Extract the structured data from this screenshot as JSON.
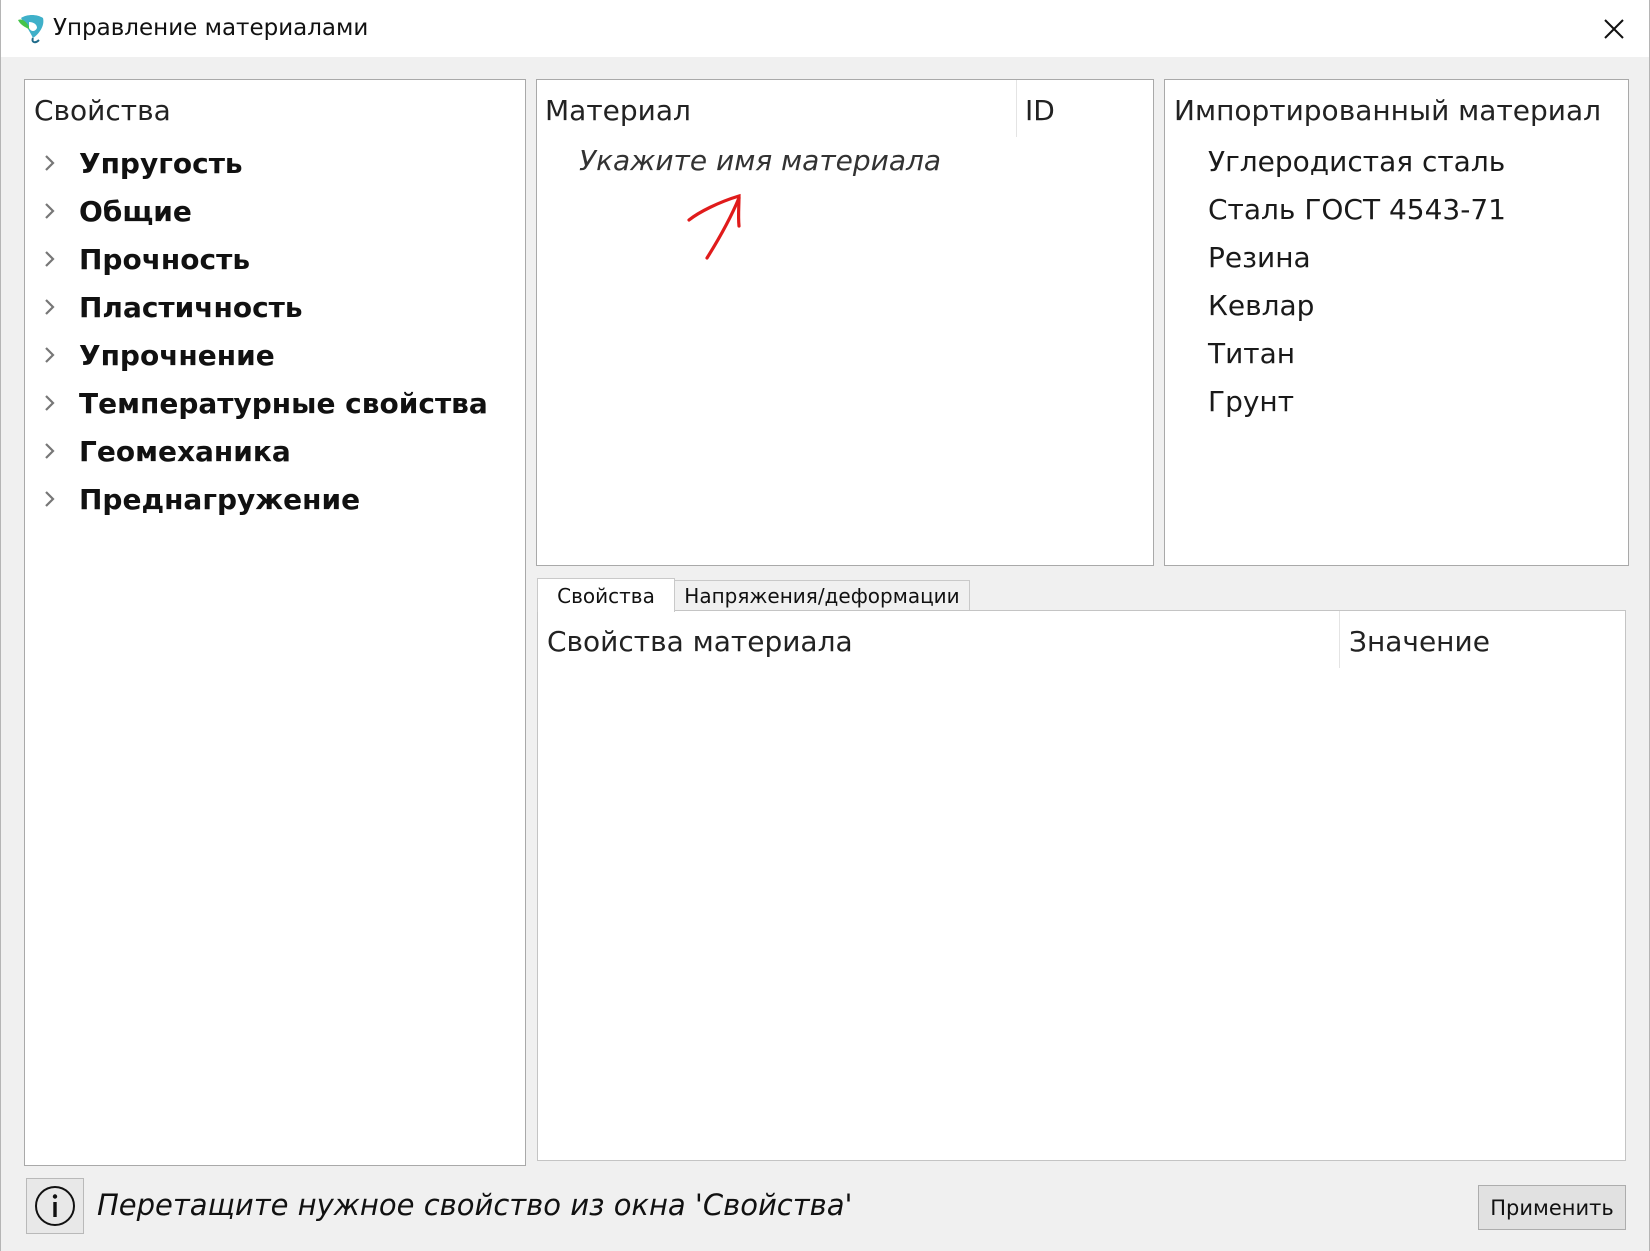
{
  "window": {
    "title": "Управление материалами",
    "accent_colors": {
      "logo_primary": "#3fb0c9",
      "logo_secondary": "#45c44a",
      "annotation": "#e01b1b"
    }
  },
  "properties_panel": {
    "header": "Свойства",
    "items": [
      {
        "label": "Упругость"
      },
      {
        "label": "Общие"
      },
      {
        "label": "Прочность"
      },
      {
        "label": "Пластичность"
      },
      {
        "label": "Упрочнение"
      },
      {
        "label": "Температурные свойства"
      },
      {
        "label": "Геомеханика"
      },
      {
        "label": "Преднагружение"
      }
    ]
  },
  "material_table": {
    "columns": [
      "Материал",
      "ID"
    ],
    "placeholder": "Укажите имя материала"
  },
  "imported_panel": {
    "header": "Импортированный материал",
    "items": [
      "Углеродистая сталь",
      "Сталь ГОСТ 4543-71",
      "Резина",
      "Кевлар",
      "Титан",
      "Грунт"
    ]
  },
  "tabs": [
    {
      "label": "Свойства",
      "active": true
    },
    {
      "label": "Напряжения/деформации",
      "active": false
    }
  ],
  "properties_table": {
    "columns": [
      "Свойства материала",
      "Значение"
    ]
  },
  "footer": {
    "hint": "Перетащите нужное свойство из окна 'Свойства'",
    "apply_label": "Применить"
  },
  "icons": {
    "app": "app-logo-icon",
    "close": "close-icon",
    "chevron": "chevron-right-icon",
    "info": "info-icon",
    "annotation": "annotation-arrow"
  }
}
